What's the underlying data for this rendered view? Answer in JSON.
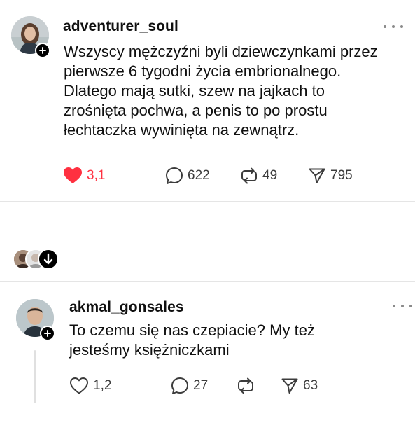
{
  "post1": {
    "username": "adventurer_soul",
    "text": "Wszyscy mężczyźni byli dziewczynkami przez\npierwsze 6 tygodni życia embrionalnego.\nDlatego mają sutki, szew na jajkach to\nzrośnięta pochwa, a penis to po prostu\nłechtaczka wywinięta na zewnątrz.",
    "likes": "3,1",
    "comments": "622",
    "reposts": "49",
    "shares": "795",
    "liked": true
  },
  "replies_indicator": {
    "avatars": [
      "avatar-a",
      "avatar-b"
    ],
    "icon": "arrow-down-icon"
  },
  "post2": {
    "username": "akmal_gonsales",
    "text": "To czemu się nas czepiacie? My też\njesteśmy  księżniczkami",
    "likes": "1,2",
    "comments": "27",
    "reposts": "",
    "shares": "63",
    "liked": false
  },
  "colors": {
    "like_active": "#ff3040",
    "text": "#101010",
    "secondary": "#3c3c3c",
    "divider": "#e5e5e5"
  }
}
